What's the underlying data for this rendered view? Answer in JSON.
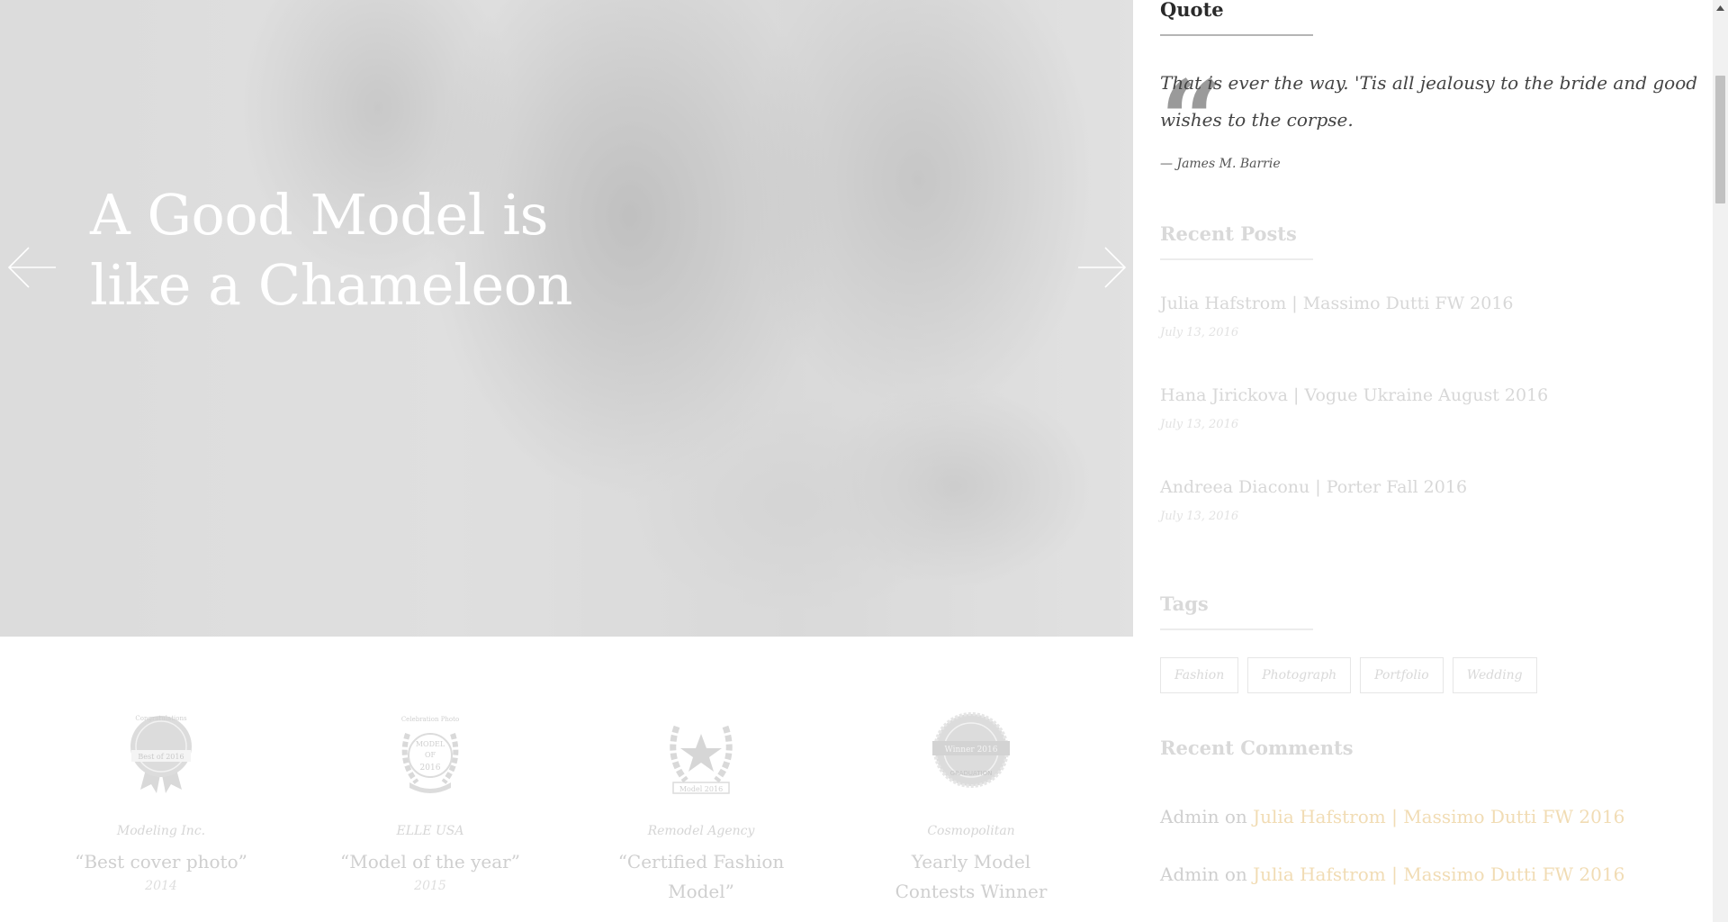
{
  "hero": {
    "title": "A Good Model is like a Chameleon",
    "prev_icon": "arrow-left-icon",
    "next_icon": "arrow-right-icon"
  },
  "awards": [
    {
      "badge_text": [
        "Congratulations",
        "Best of 2016"
      ],
      "organization": "Modeling Inc.",
      "title": "“Best cover photo”",
      "year": "2014"
    },
    {
      "badge_text": [
        "Celebration Photo",
        "MODEL",
        "OF",
        "2016"
      ],
      "organization": "ELLE USA",
      "title": "“Model of the year”",
      "year": "2015"
    },
    {
      "badge_text": [
        "Model 2016"
      ],
      "organization": "Remodel Agency",
      "title": "“Certified Fashion Model”",
      "year": ""
    },
    {
      "badge_text": [
        "Winner 2016",
        "GRADUATION"
      ],
      "organization": "Cosmopolitan",
      "title": "Yearly Model Contests Winner",
      "year": ""
    }
  ],
  "sidebar": {
    "quote": {
      "title": "Quote",
      "text": "That is ever the way. 'Tis all jealousy to the bride and good wishes to the corpse.",
      "author": "— James M. Barrie"
    },
    "recent_posts": {
      "title": "Recent Posts",
      "items": [
        {
          "title": "Julia Hafstrom | Massimo Dutti FW 2016",
          "date": "July 13, 2016"
        },
        {
          "title": "Hana Jirickova | Vogue Ukraine August 2016",
          "date": "July 13, 2016"
        },
        {
          "title": "Andreea Diaconu | Porter Fall 2016",
          "date": "July 13, 2016"
        }
      ]
    },
    "tags": {
      "title": "Tags",
      "items": [
        "Fashion",
        "Photograph",
        "Portfolio",
        "Wedding"
      ]
    },
    "recent_comments": {
      "title": "Recent Comments",
      "items": [
        {
          "author": "Admin",
          "on": "on",
          "post": "Julia Hafstrom | Massimo Dutti FW 2016"
        },
        {
          "author": "Admin",
          "on": "on",
          "post": "Julia Hafstrom | Massimo Dutti FW 2016"
        }
      ]
    }
  },
  "colors": {
    "accent_link": "#f1dcb4",
    "heading_dark": "#2a2a2a",
    "faded_text": "#d7d7d7"
  }
}
